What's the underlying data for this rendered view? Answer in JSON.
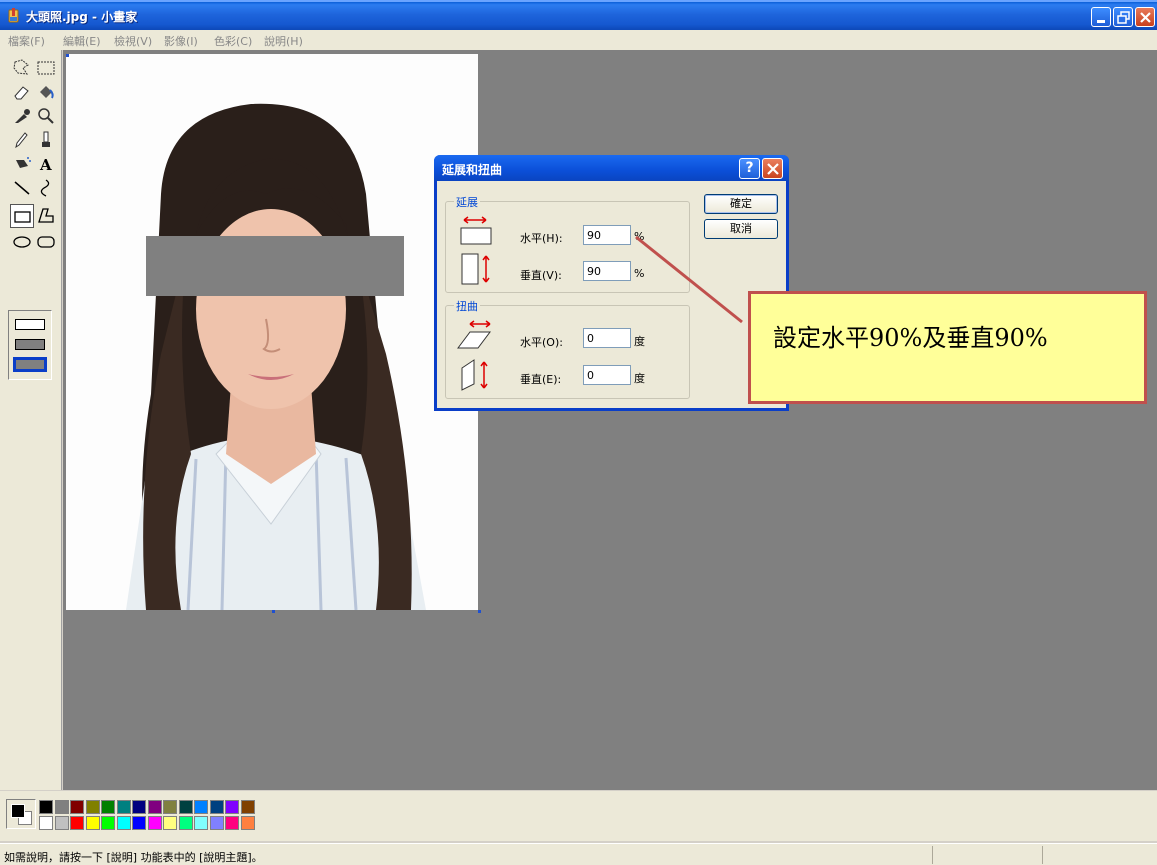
{
  "window": {
    "title": "大頭照.jpg - 小畫家",
    "icon": "paint-brush-icon",
    "controls": [
      "minimize-icon",
      "restore-icon",
      "close-icon"
    ]
  },
  "menu": [
    "檔案(F)",
    "編輯(E)",
    "檢視(V)",
    "影像(I)",
    "色彩(C)",
    "說明(H)"
  ],
  "toolbox": {
    "tools": [
      "free-form-select-icon",
      "rect-select-icon",
      "eraser-icon",
      "fill-bucket-icon",
      "color-picker-icon",
      "magnifier-icon",
      "pencil-icon",
      "brush-icon",
      "airbrush-icon",
      "text-icon",
      "line-icon",
      "curve-icon",
      "rectangle-icon",
      "polygon-icon",
      "ellipse-icon",
      "rounded-rect-icon"
    ],
    "selected_tool": "rectangle-icon"
  },
  "dialog": {
    "title": "延展和扭曲",
    "stretch_group": "延展",
    "skew_group": "扭曲",
    "stretch_h_label": "水平(H):",
    "stretch_h_value": "90",
    "stretch_v_label": "垂直(V):",
    "stretch_v_value": "90",
    "percent_unit": "%",
    "skew_h_label": "水平(O):",
    "skew_h_value": "0",
    "skew_v_label": "垂直(E):",
    "skew_v_value": "0",
    "degree_unit": "度",
    "ok_label": "確定",
    "cancel_label": "取消",
    "help_label": "?"
  },
  "callout": {
    "text": "設定水平90%及垂直90%"
  },
  "palette": {
    "colors_top": [
      "#000000",
      "#808080",
      "#800000",
      "#808000",
      "#008000",
      "#008080",
      "#000080",
      "#800080",
      "#808040",
      "#004040",
      "#0080ff",
      "#004080",
      "#8000ff",
      "#804000"
    ],
    "colors_bottom": [
      "#ffffff",
      "#c0c0c0",
      "#ff0000",
      "#ffff00",
      "#00ff00",
      "#00ffff",
      "#0000ff",
      "#ff00ff",
      "#ffff80",
      "#00ff80",
      "#80ffff",
      "#8080ff",
      "#ff0080",
      "#ff8040"
    ],
    "foreground": "#000000",
    "background": "#ffffff"
  },
  "status": {
    "text": "如需說明，請按一下 [說明] 功能表中的 [說明主題]。"
  }
}
